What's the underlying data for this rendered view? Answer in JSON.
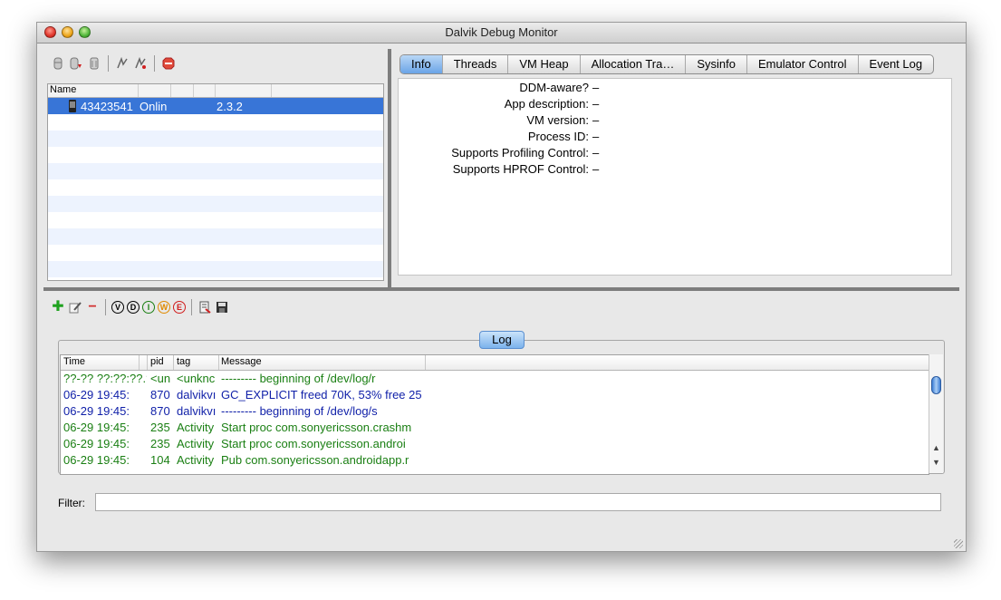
{
  "window": {
    "title": "Dalvik Debug Monitor"
  },
  "device_toolbar": {
    "icons": [
      "debug-icon",
      "update-heap-icon",
      "dump-hprof-icon",
      "cause-gc-icon",
      "update-threads-icon",
      "start-method-profiling-icon",
      "stop-process-icon"
    ]
  },
  "device_list": {
    "columns": [
      "Name",
      "",
      "",
      "",
      "",
      ""
    ],
    "rows": [
      {
        "icon": "phone-icon",
        "name": "43423541",
        "status": "Onlin",
        "version": "2.3.2"
      }
    ]
  },
  "tabs": [
    "Info",
    "Threads",
    "VM Heap",
    "Allocation Tra…",
    "Sysinfo",
    "Emulator Control",
    "Event Log"
  ],
  "active_tab": "Info",
  "info": [
    {
      "label": "DDM-aware?",
      "value": "–"
    },
    {
      "label": "App description:",
      "value": "–"
    },
    {
      "label": "VM version:",
      "value": "–"
    },
    {
      "label": "Process ID:",
      "value": "–"
    },
    {
      "label": "Supports Profiling Control:",
      "value": "–"
    },
    {
      "label": "Supports HPROF Control:",
      "value": "–"
    }
  ],
  "log_toolbar": {
    "levels": [
      "V",
      "D",
      "I",
      "W",
      "E"
    ],
    "level_colors": {
      "V": "#000000",
      "D": "#000000",
      "I": "#1a7f13",
      "W": "#e08a00",
      "E": "#d01c1c"
    }
  },
  "log": {
    "button": "Log",
    "columns": [
      "Time",
      "pid",
      "tag",
      "Message"
    ],
    "rows": [
      {
        "time": "??-?? ??:??:??.?",
        "pid": "<un",
        "tag": "<unknc",
        "message": "--------- beginning of /dev/log/r",
        "color": "green"
      },
      {
        "time": "06-29 19:45:",
        "pid": "870",
        "tag": "dalvikvı",
        "message": "GC_EXPLICIT freed 70K, 53% free 25",
        "color": "blue"
      },
      {
        "time": "06-29 19:45:",
        "pid": "870",
        "tag": "dalvikvı",
        "message": "--------- beginning of /dev/log/s",
        "color": "blue"
      },
      {
        "time": "06-29 19:45:",
        "pid": "235",
        "tag": "Activity",
        "message": "Start proc com.sonyericsson.crashm",
        "color": "green"
      },
      {
        "time": "06-29 19:45:",
        "pid": "235",
        "tag": "Activity",
        "message": "Start proc com.sonyericsson.androi",
        "color": "green"
      },
      {
        "time": "06-29 19:45:",
        "pid": "104",
        "tag": "Activity",
        "message": "Pub com.sonyericsson.androidapp.r",
        "color": "green"
      }
    ]
  },
  "filter": {
    "label": "Filter:",
    "value": ""
  }
}
